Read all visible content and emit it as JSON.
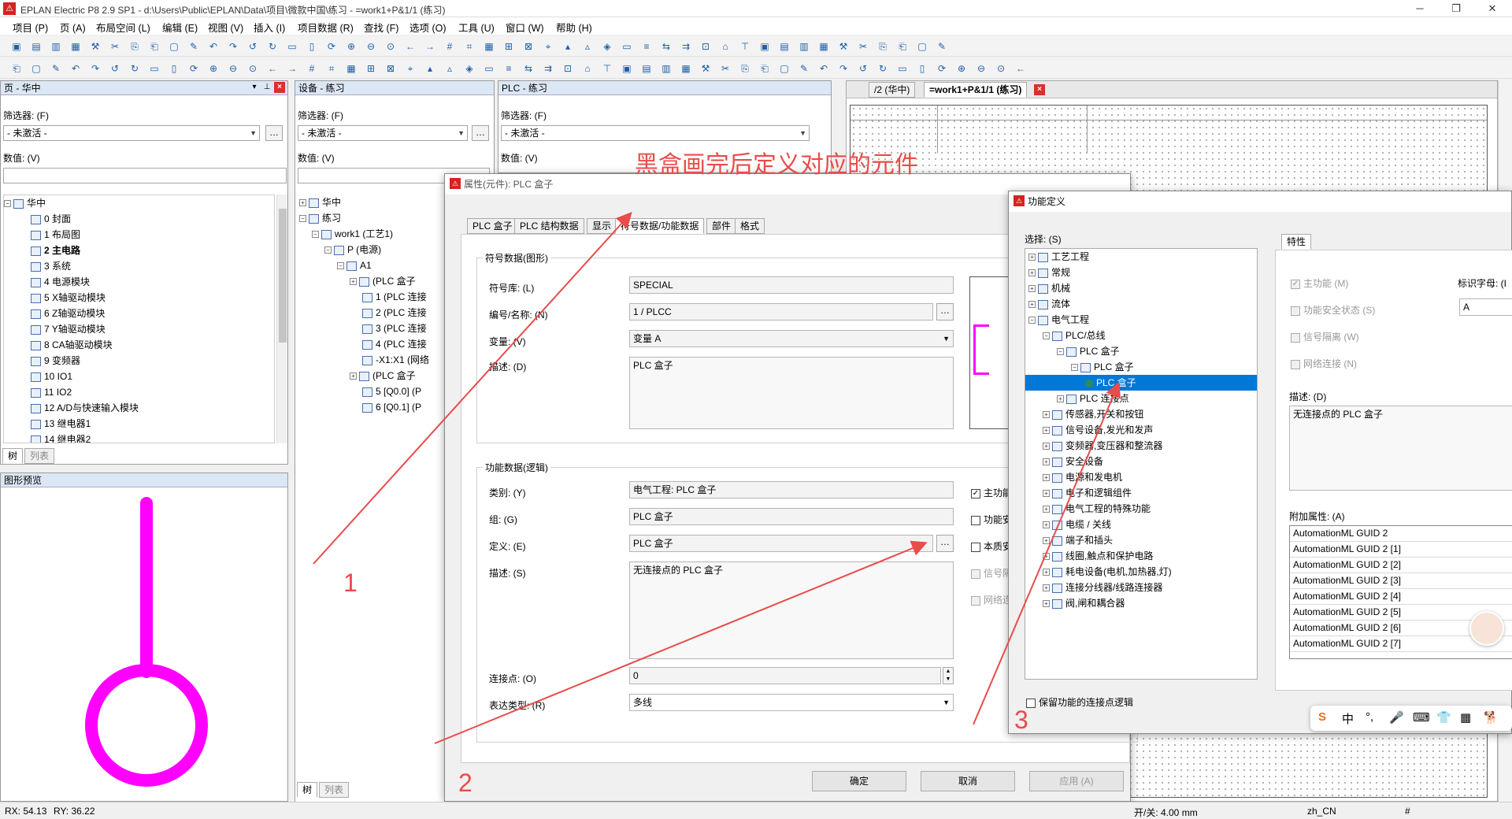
{
  "window": {
    "title": "EPLAN Electric P8 2.9 SP1 - d:\\Users\\Public\\EPLAN\\Data\\项目\\微款中国\\练习 - =work1+P&1/1 (练习)",
    "controls": [
      "─",
      "❐",
      "✕"
    ]
  },
  "menu": [
    "项目 (P)",
    "页 (A)",
    "布局空间 (L)",
    "编辑 (E)",
    "视图 (V)",
    "插入 (I)",
    "项目数据 (R)",
    "查找 (F)",
    "选项 (O)",
    "工具 (U)",
    "窗口 (W)",
    "帮助 (H)"
  ],
  "pages_panel": {
    "title": "页 - 华中",
    "filter_label": "筛选器: (F)",
    "filter_value": "- 未激活 -",
    "value_label": "数值: (V)",
    "root": "华中",
    "items": [
      "0 封面",
      "1 布局图",
      "2 主电路",
      "3 系统",
      "4 电源模块",
      "5 X轴驱动模块",
      "6 Z轴驱动模块",
      "7 Y轴驱动模块",
      "8 CA轴驱动模块",
      "9 变频器",
      "10 IO1",
      "11 IO2",
      "12 A/D与快速输入模块",
      "13 继电器1",
      "14 继电器2"
    ],
    "tabs": [
      "树",
      "列表"
    ]
  },
  "preview_panel": {
    "title": "图形预览"
  },
  "devices_panel": {
    "title": "设备 - 练习",
    "filter_label": "筛选器: (F)",
    "filter_value": "- 未激活 -",
    "value_label": "数值: (V)",
    "items": [
      "华中",
      "练习",
      "work1 (工艺1)",
      "P (电源)",
      "A1",
      "(PLC 盒子",
      "1 (PLC 连接",
      "2 (PLC 连接",
      "3 (PLC 连接",
      "4 (PLC 连接",
      "-X1:X1 (网络",
      "(PLC 盒子",
      "5 [Q0.0] (P",
      "6 [Q0.1] (P"
    ],
    "tabs": [
      "树",
      "列表"
    ]
  },
  "plc_panel": {
    "title": "PLC - 练习",
    "filter_label": "筛选器: (F)",
    "filter_value": "- 未激活 -",
    "value_label": "数值: (V)"
  },
  "editor_tabs": [
    "/2 (华中)",
    "=work1+P&1/1 (练习)"
  ],
  "annotation_title": "黑盒画完后定义对应的元件",
  "annotation_numbers": [
    "1",
    "2",
    "3"
  ],
  "props_dialog": {
    "title": "属性(元件): PLC 盒子",
    "tabs": [
      "PLC 盒子",
      "PLC 结构数据",
      "显示",
      "符号数据/功能数据",
      "部件",
      "格式"
    ],
    "symbol_group": "符号数据(图形)",
    "symlib_label": "符号库: (L)",
    "symlib_value": "SPECIAL",
    "number_label": "编号/名称: (N)",
    "number_value": "1 / PLCC",
    "variant_label": "变量: (V)",
    "variant_value": "变量 A",
    "desc_label": "描述: (D)",
    "desc_value": "PLC 盒子",
    "func_group": "功能数据(逻辑)",
    "category_label": "类别: (Y)",
    "category_value": "电气工程: PLC 盒子",
    "group_label": "组: (G)",
    "group_value": "PLC 盒子",
    "def_label": "定义: (E)",
    "def_value": "PLC 盒子",
    "fdesc_label": "描述: (S)",
    "fdesc_value": "无连接点的 PLC 盒子",
    "conn_label": "连接点: (O)",
    "conn_value": "0",
    "repr_label": "表达类型: (R)",
    "repr_value": "多线",
    "checks": [
      "主功能",
      "功能安",
      "本质安",
      "信号隔",
      "网络连"
    ],
    "ok": "确定",
    "cancel": "取消",
    "apply": "应用 (A)"
  },
  "func_dialog": {
    "title": "功能定义",
    "select_label": "选择: (S)",
    "tree": [
      "工艺工程",
      "常规",
      "机械",
      "流体",
      "电气工程",
      "PLC/总线",
      "PLC 盒子",
      "PLC 盒子",
      "PLC 盒子",
      "PLC 连接点",
      "传感器,开关和按钮",
      "信号设备,发光和发声",
      "变频器,变压器和整流器",
      "安全设备",
      "电源和发电机",
      "电子和逻辑组件",
      "电气工程的特殊功能",
      "电缆 / 关线",
      "端子和插头",
      "线圈,触点和保护电路",
      "耗电设备(电机,加热器,灯)",
      "连接分线器/线路连接器",
      "阀,闸和耦合器"
    ],
    "tab_props": "特性",
    "main_func": "主功能 (M)",
    "func_safety": "功能安全状态 (S)",
    "signal_iso": "信号隔离 (W)",
    "network": "网络连接 (N)",
    "id_letter_label": "标识字母: (I",
    "id_letter_value": "A",
    "desc_label": "描述: (D)",
    "desc_value": "无连接点的 PLC 盒子",
    "extra_label": "附加属性: (A)",
    "extra_rows": [
      "AutomationML GUID 2",
      "AutomationML GUID 2 [1]",
      "AutomationML GUID 2 [2]",
      "AutomationML GUID 2 [3]",
      "AutomationML GUID 2 [4]",
      "AutomationML GUID 2 [5]",
      "AutomationML GUID 2 [6]",
      "AutomationML GUID 2 [7]"
    ],
    "keep_logic": "保留功能的连接点逻辑"
  },
  "status": {
    "rx": "RX: 54.13",
    "ry": "RY: 36.22",
    "grid": "开/关: 4.00 mm",
    "lang": "zh_CN",
    "hash": "#"
  },
  "ime_bar": [
    "S",
    "中",
    "°,",
    "🎤",
    "⌨",
    "👕",
    "▦",
    "🐕"
  ],
  "colors": {
    "accent": "#ff00ff",
    "annotation": "#ea4b4b",
    "selection": "#0078d7",
    "logo": "#d6231f"
  }
}
